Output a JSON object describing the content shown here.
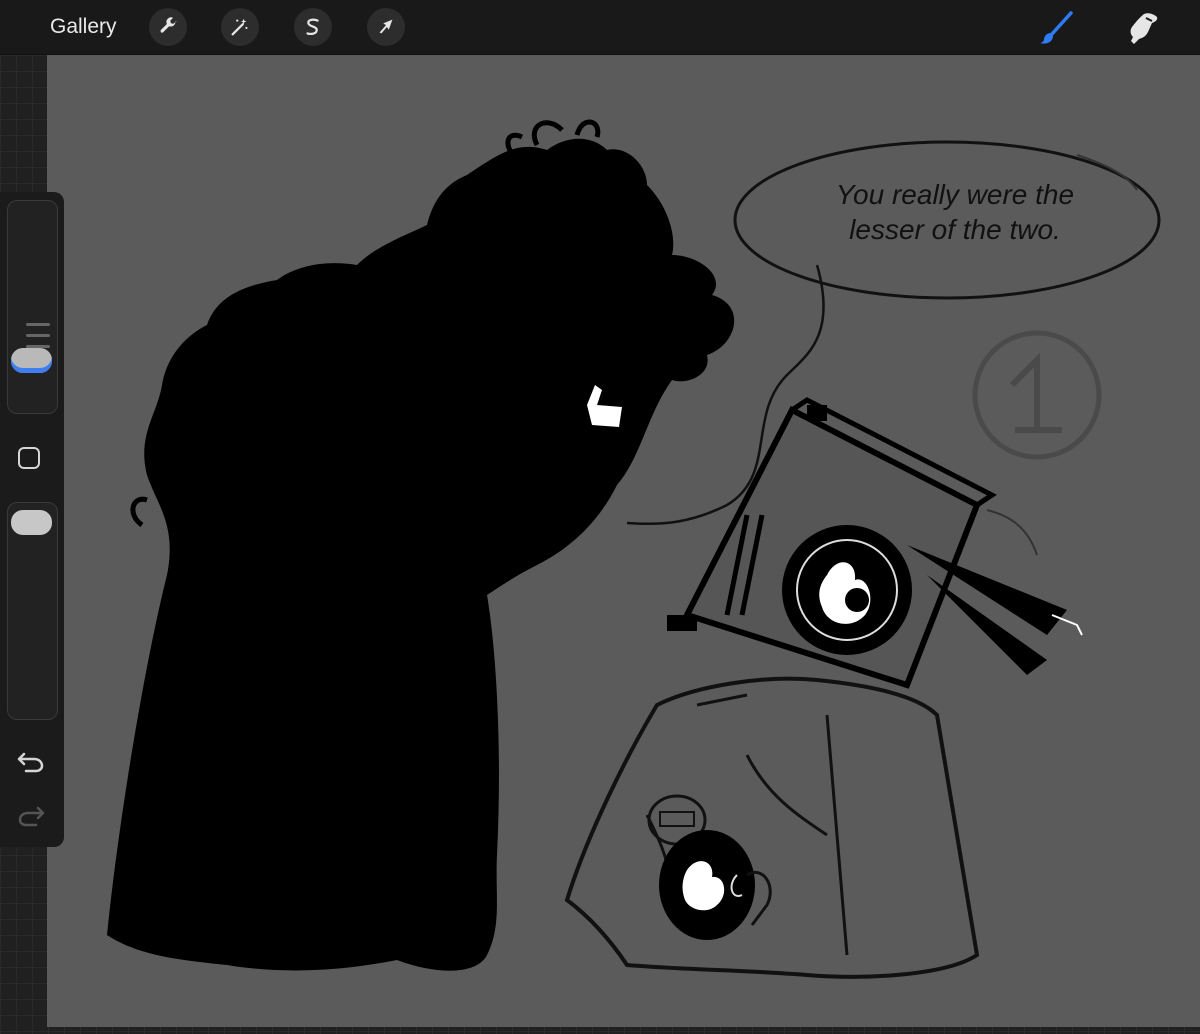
{
  "topbar": {
    "gallery_label": "Gallery",
    "tools": [
      {
        "name": "wrench-icon",
        "label": "Actions"
      },
      {
        "name": "magic-wand-icon",
        "label": "Adjustments"
      },
      {
        "name": "selection-s-icon",
        "label": "Selection"
      },
      {
        "name": "arrow-cursor-icon",
        "label": "Transform"
      }
    ],
    "right_tools": [
      {
        "name": "brush-icon",
        "active": true
      },
      {
        "name": "smudge-icon",
        "active": false
      }
    ],
    "accent_color": "#2f7bf6"
  },
  "sidebar": {
    "icons": [
      "square-modify-icon",
      "undo-icon",
      "redo-icon"
    ]
  },
  "canvas": {
    "background_color": "#5b5b5b",
    "speech_bubble": {
      "line1": "You really were the",
      "line2": "lesser of the two."
    },
    "panel_number": "1"
  }
}
